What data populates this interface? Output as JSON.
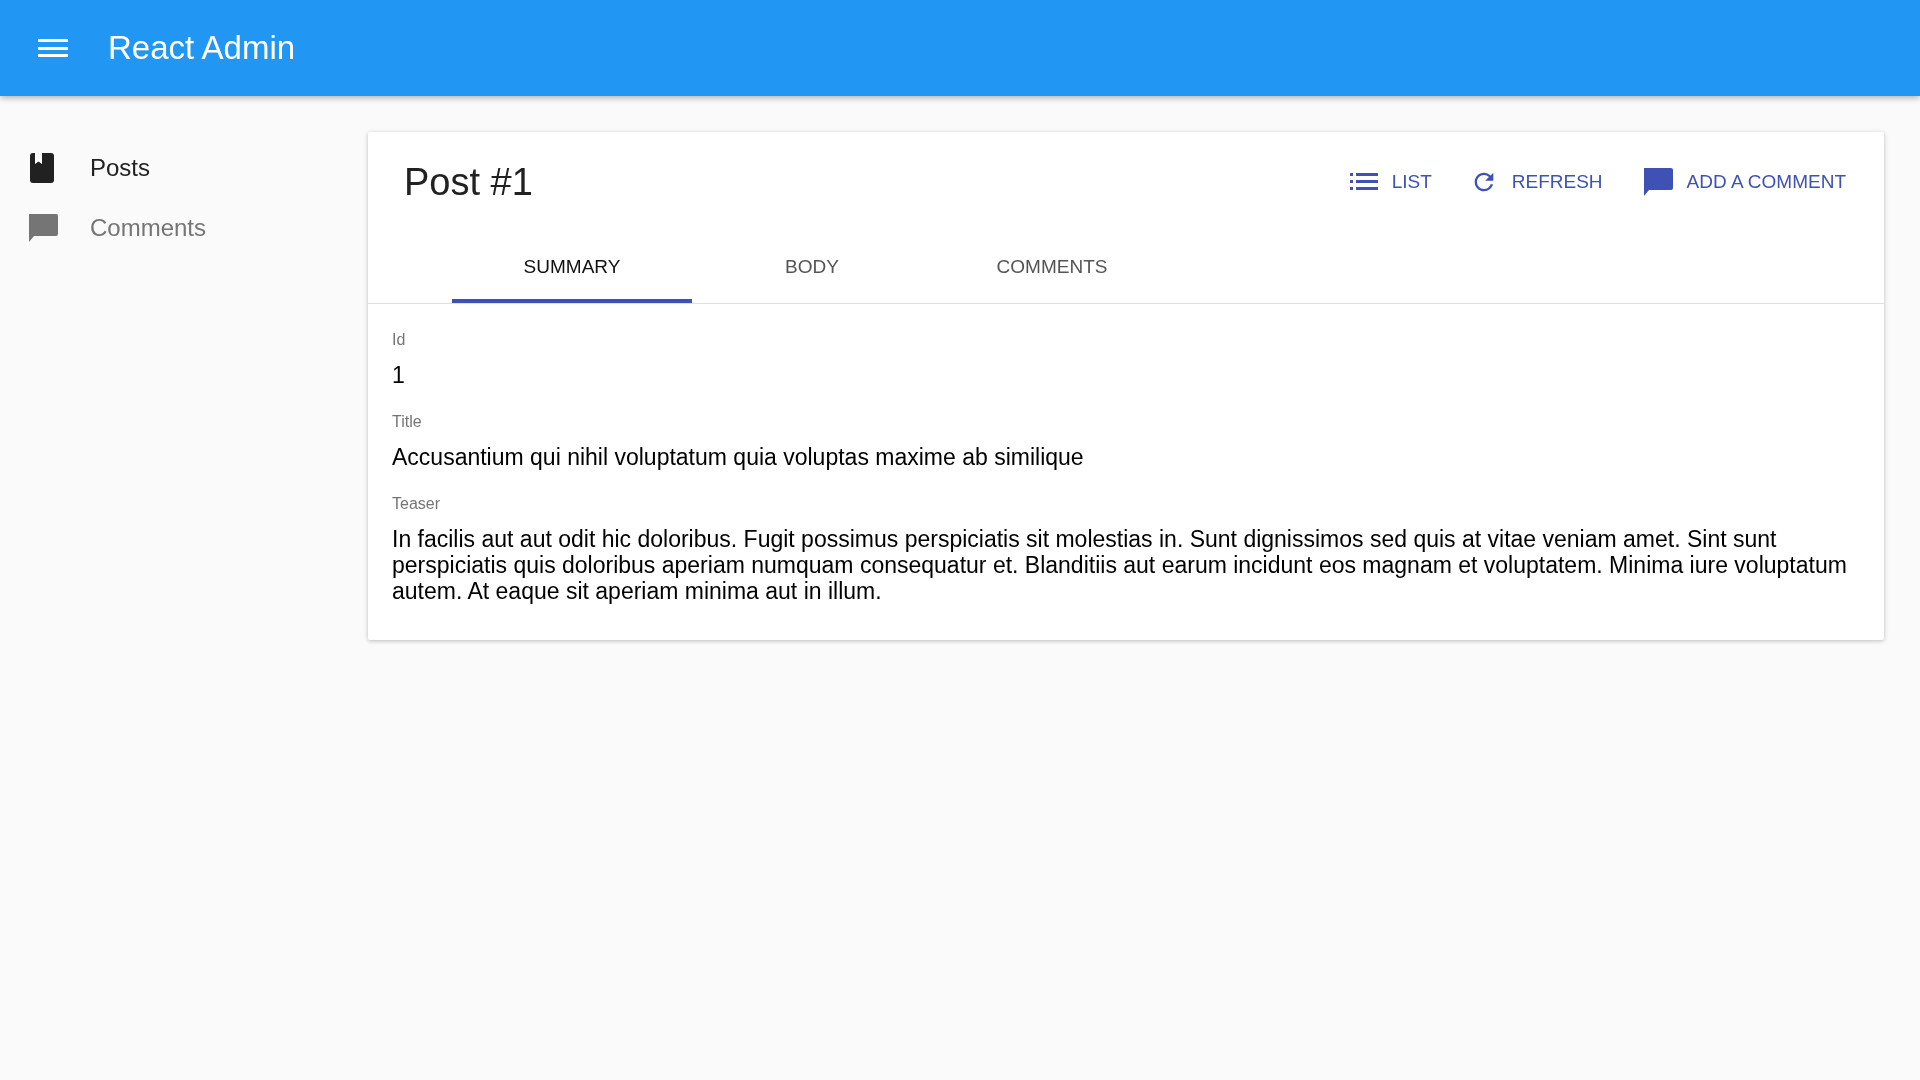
{
  "app_bar": {
    "title": "React Admin"
  },
  "sidebar": {
    "items": [
      {
        "label": "Posts",
        "kind": "posts",
        "selected": true
      },
      {
        "label": "Comments",
        "kind": "comments",
        "selected": false
      }
    ]
  },
  "card": {
    "title": "Post #1",
    "actions": [
      {
        "label": "LIST",
        "kind": "list"
      },
      {
        "label": "REFRESH",
        "kind": "refresh"
      },
      {
        "label": "ADD A COMMENT",
        "kind": "comment"
      }
    ],
    "tabs": [
      {
        "label": "SUMMARY",
        "selected": true
      },
      {
        "label": "BODY",
        "selected": false
      },
      {
        "label": "COMMENTS",
        "selected": false
      }
    ],
    "fields": [
      {
        "label": "Id",
        "value": "1"
      },
      {
        "label": "Title",
        "value": "Accusantium qui nihil voluptatum quia voluptas maxime ab similique"
      },
      {
        "label": "Teaser",
        "value": "In facilis aut aut odit hic doloribus. Fugit possimus perspiciatis sit molestias in. Sunt dignissimos sed quis at vitae veniam amet. Sint sunt perspiciatis quis doloribus aperiam numquam consequatur et. Blanditiis aut earum incidunt eos magnam et voluptatem. Minima iure voluptatum autem. At eaque sit aperiam minima aut in illum."
      }
    ]
  }
}
